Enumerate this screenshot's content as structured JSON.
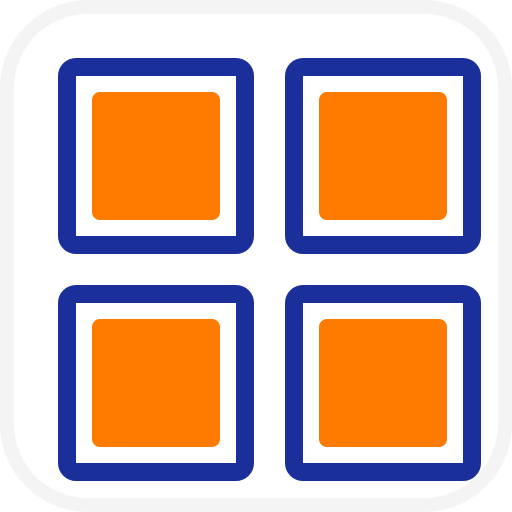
{
  "icon": {
    "name": "grid-tiles-icon",
    "colors": {
      "frame": "#1b2f9a",
      "fill": "#ff7b00",
      "gap": "#ffffff",
      "background": "#f4f4f4"
    },
    "tiles": [
      {
        "position": "top-left"
      },
      {
        "position": "top-right"
      },
      {
        "position": "bottom-left"
      },
      {
        "position": "bottom-right"
      }
    ]
  }
}
